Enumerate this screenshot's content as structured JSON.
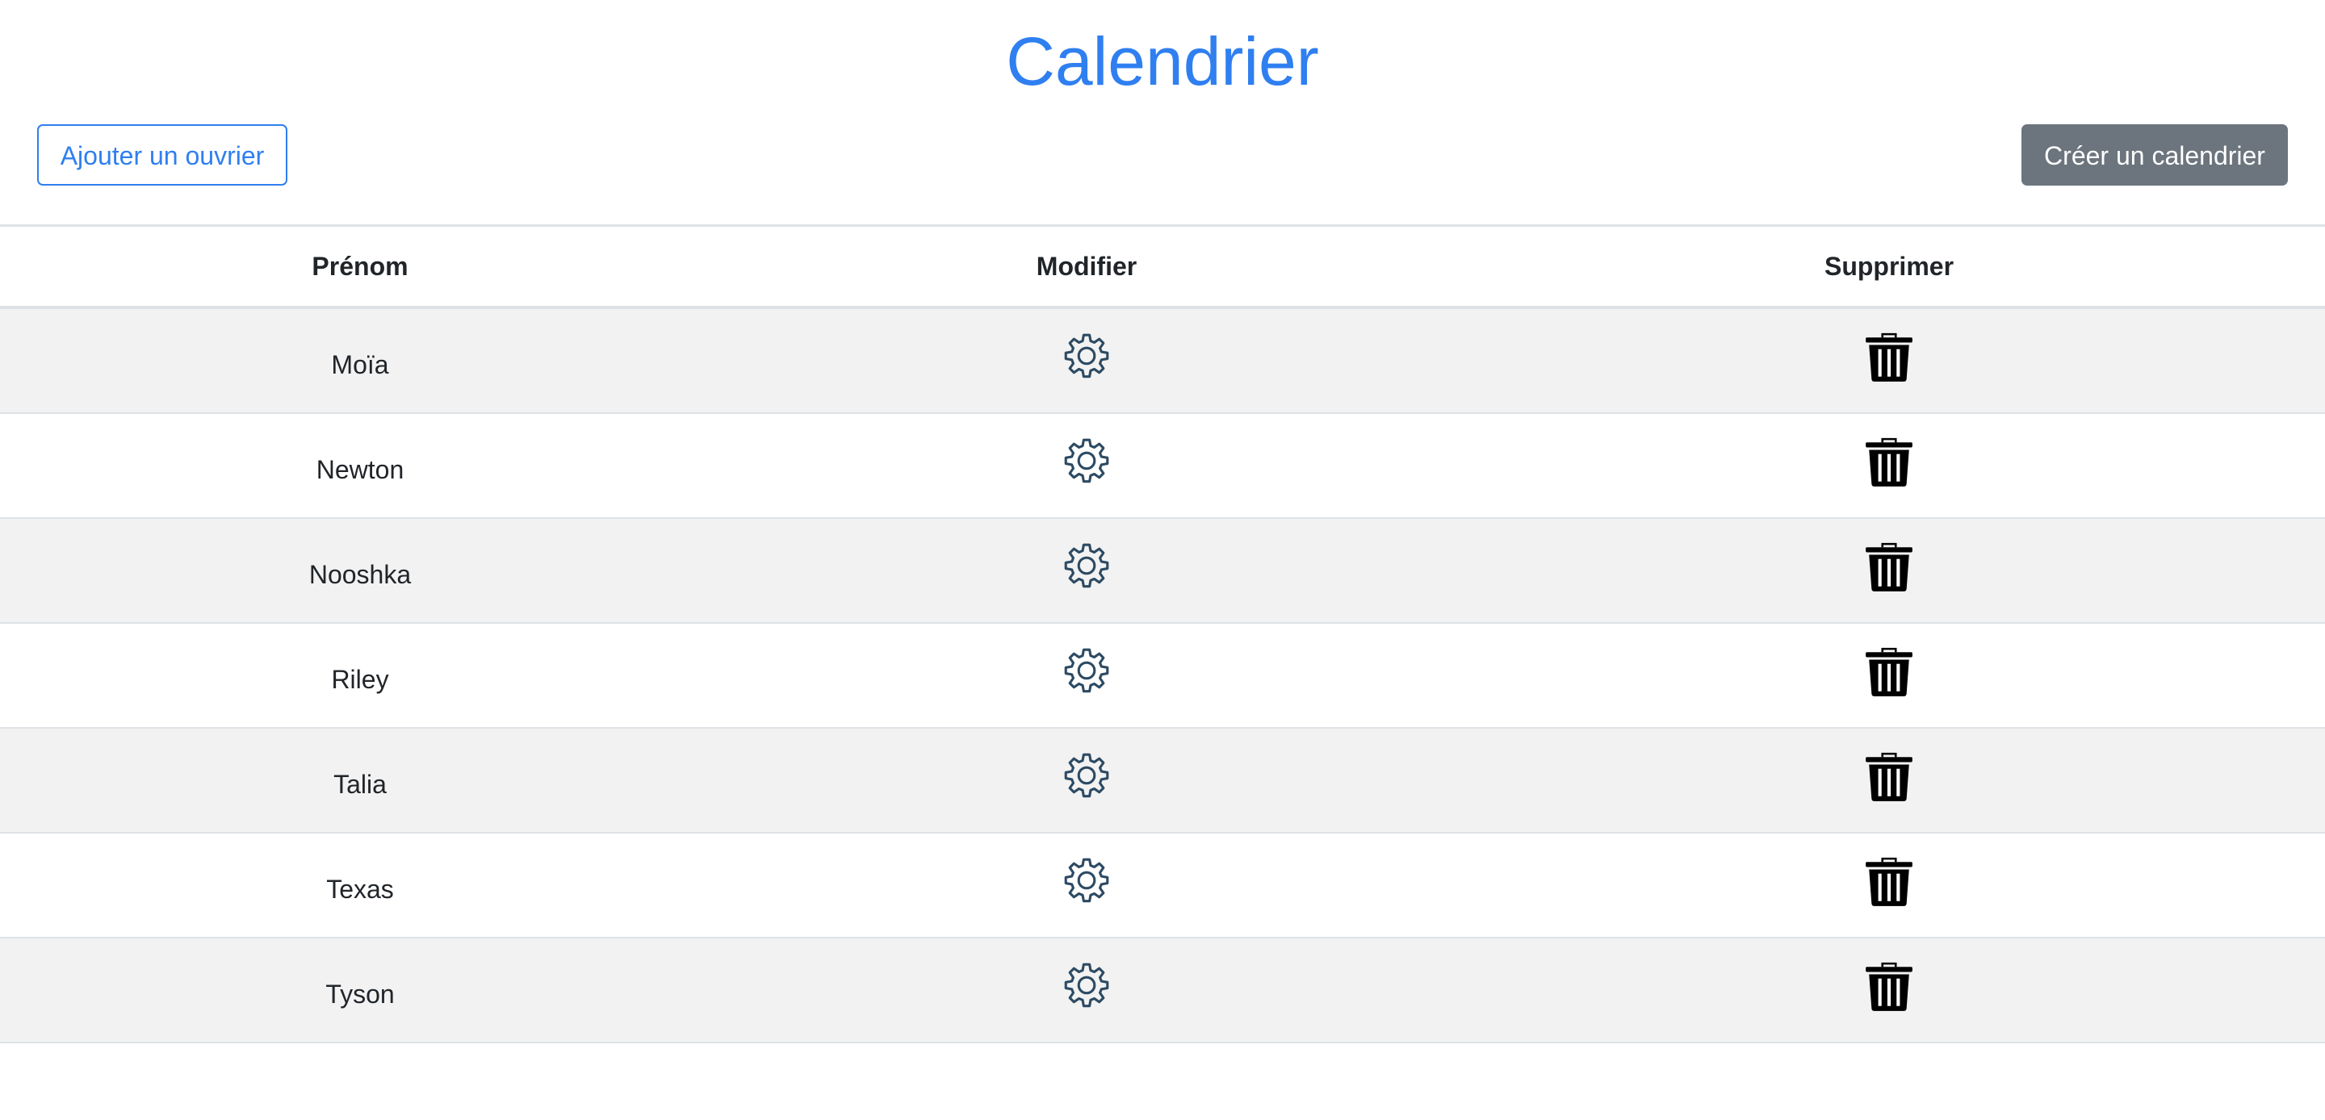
{
  "header": {
    "title": "Calendrier",
    "add_worker_label": "Ajouter un ouvrier",
    "create_calendar_label": "Créer un calendrier"
  },
  "colors": {
    "primary": "#2f7ff0",
    "secondary": "#6c757d",
    "stripe": "#f2f2f2",
    "gear": "#2c4a63",
    "trash": "#000000"
  },
  "table": {
    "columns": [
      "Prénom",
      "Modifier",
      "Supprimer"
    ],
    "rows": [
      {
        "name": "Moïa",
        "edit_icon": "gear-icon",
        "delete_icon": "trash-icon"
      },
      {
        "name": "Newton",
        "edit_icon": "gear-icon",
        "delete_icon": "trash-icon"
      },
      {
        "name": "Nooshka",
        "edit_icon": "gear-icon",
        "delete_icon": "trash-icon"
      },
      {
        "name": "Riley",
        "edit_icon": "gear-icon",
        "delete_icon": "trash-icon"
      },
      {
        "name": "Talia",
        "edit_icon": "gear-icon",
        "delete_icon": "trash-icon"
      },
      {
        "name": "Texas",
        "edit_icon": "gear-icon",
        "delete_icon": "trash-icon"
      },
      {
        "name": "Tyson",
        "edit_icon": "gear-icon",
        "delete_icon": "trash-icon"
      }
    ]
  }
}
